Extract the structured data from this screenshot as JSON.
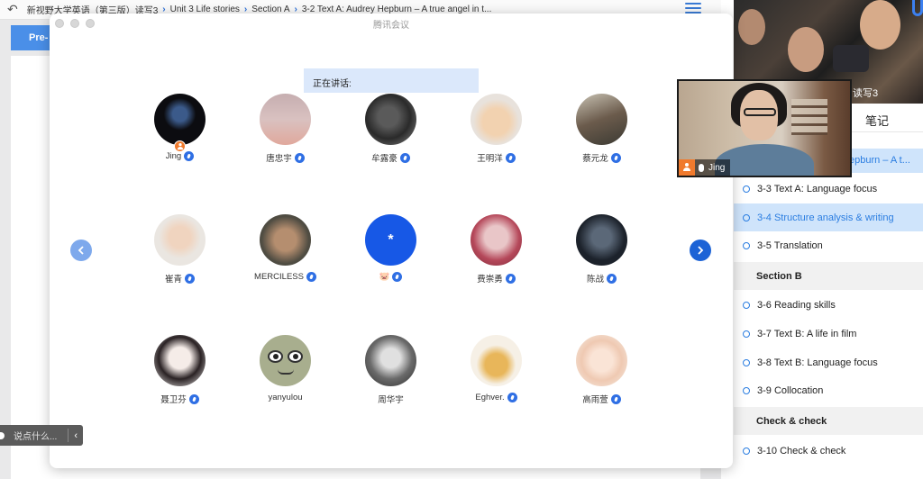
{
  "browser": {
    "back_icon": "back-arrow-icon",
    "breadcrumbs": [
      "新视野大学英语（第三版）读写3",
      "Unit 3 Life stories",
      "Section A",
      "3-2 Text A: Audrey Hepburn – A true angel in t..."
    ],
    "pre_button": "Pre-"
  },
  "meeting": {
    "title": "腾讯会议",
    "speaking_label": "正在讲话:",
    "participants": [
      {
        "name": "Jing",
        "avatar": "photo-dark"
      },
      {
        "name": "唐忠宇",
        "avatar": "photo-pink"
      },
      {
        "name": "牟露豪",
        "avatar": "photo-gray"
      },
      {
        "name": "王明洋",
        "avatar": "photo-cat"
      },
      {
        "name": "蔡元龙",
        "avatar": "photo-scene"
      },
      {
        "name": "崔青",
        "avatar": "photo-boy"
      },
      {
        "name": "MERCILESS",
        "avatar": "photo-kid"
      },
      {
        "name": "🐷",
        "avatar": "*"
      },
      {
        "name": "费崇勇",
        "avatar": "photo-anime-red"
      },
      {
        "name": "陈战",
        "avatar": "photo-dark-figure"
      },
      {
        "name": "聂卫芬",
        "avatar": "photo-anime-girl"
      },
      {
        "name": "yanyulou",
        "avatar": "photo-cartoon"
      },
      {
        "name": "周华宇",
        "avatar": "photo-bw"
      },
      {
        "name": "Eghver.",
        "avatar": "photo-sticker"
      },
      {
        "name": "高雨萱",
        "avatar": "photo-anime-boy"
      }
    ],
    "self_video": {
      "name": "Jing"
    },
    "chat_placeholder": "说点什么..."
  },
  "side_panel": {
    "course_label": "读写3",
    "notes_tab": "笔记",
    "partial_item": "epburn – A t...",
    "items": [
      {
        "type": "lesson",
        "label": "3-3 Text A: Language focus",
        "active": false
      },
      {
        "type": "lesson",
        "label": "3-4 Structure analysis & writing",
        "active": true
      },
      {
        "type": "lesson",
        "label": "3-5 Translation",
        "active": false
      },
      {
        "type": "section",
        "label": "Section B"
      },
      {
        "type": "lesson",
        "label": "3-6 Reading skills",
        "active": false
      },
      {
        "type": "lesson",
        "label": "3-7 Text B: A life in film",
        "active": false
      },
      {
        "type": "lesson",
        "label": "3-8 Text B: Language focus",
        "active": false
      },
      {
        "type": "lesson",
        "label": "3-9 Collocation",
        "active": false
      },
      {
        "type": "section",
        "label": "Check & check"
      },
      {
        "type": "lesson",
        "label": "3-10 Check & check",
        "active": false
      }
    ]
  },
  "colors": {
    "accent": "#2f6fe4",
    "host": "#f07a2d",
    "active_row": "#cfe4fb"
  }
}
